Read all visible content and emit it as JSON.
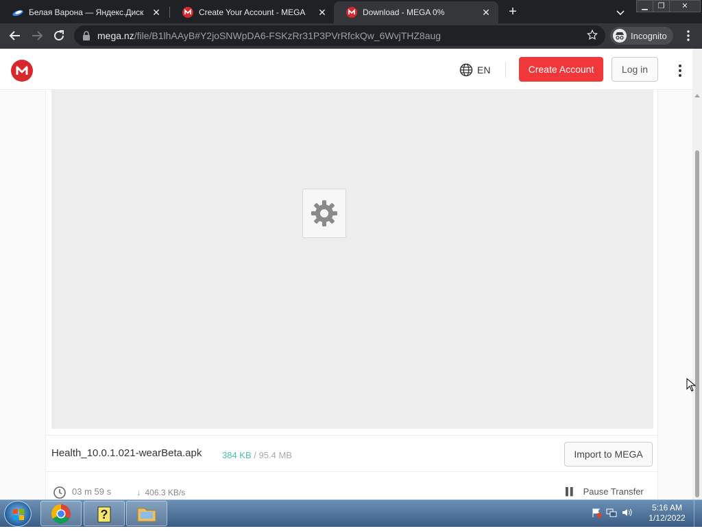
{
  "browser": {
    "tabs": [
      {
        "title": "Белая Варона — Яндекс.Диск",
        "active": false
      },
      {
        "title": "Create Your Account - MEGA",
        "active": false
      },
      {
        "title": "Download - MEGA 0%",
        "active": true
      }
    ],
    "new_tab_icon": "plus-icon",
    "url_host": "mega.nz",
    "url_path": "/file/B1lhAAyB#Y2joSNWpDA6-FSKzRr31P3PVrRfckQw_6WvjTHZ8aug",
    "incognito_label": "Incognito"
  },
  "header": {
    "logo_letter": "M",
    "language": "EN",
    "create_account_label": "Create Account",
    "login_label": "Log in"
  },
  "file": {
    "name": "Health_10.0.1.021-wearBeta.apk",
    "downloaded": "384 KB",
    "separator": "/",
    "total": "95.4 MB",
    "import_label": "Import to MEGA"
  },
  "transfer": {
    "eta": "03 m  59 s",
    "speed": "406.3 KB/s",
    "pause_label": "Pause Transfer"
  },
  "taskbar": {
    "time": "5:16 AM",
    "date": "1/12/2022"
  },
  "colors": {
    "mega_red": "#d9272e",
    "create_button": "#f0373a",
    "progress_green": "#4dbfa7"
  }
}
